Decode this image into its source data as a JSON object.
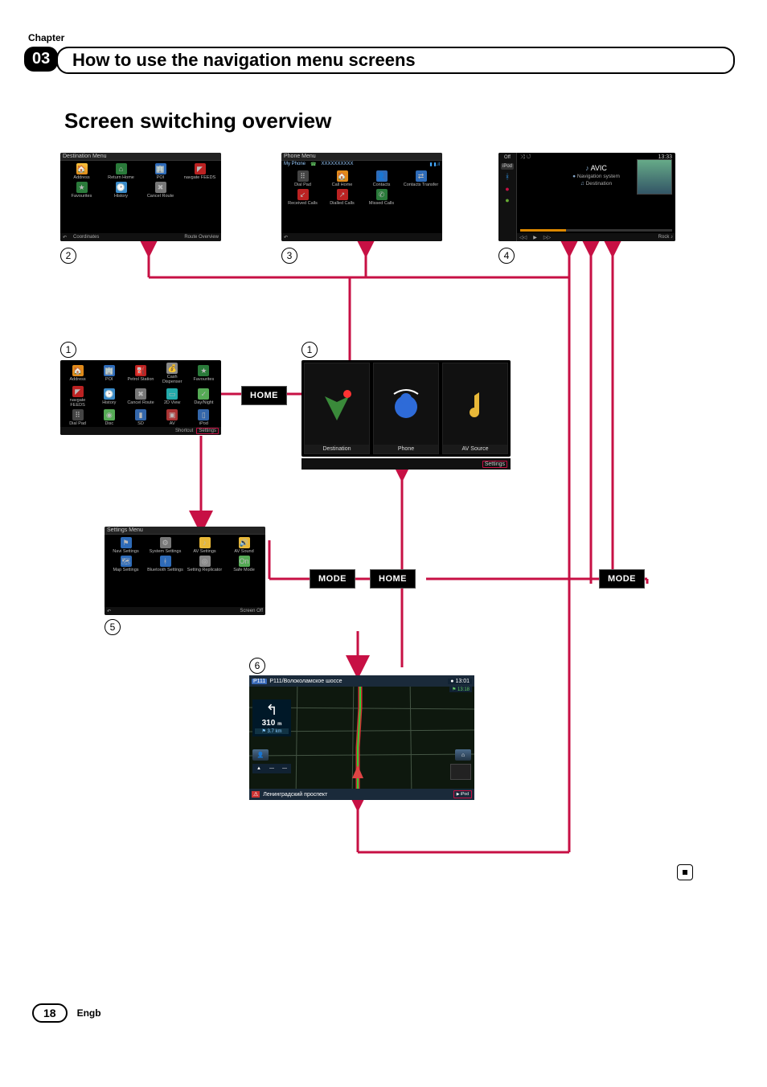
{
  "chapter": {
    "label": "Chapter",
    "number": "03"
  },
  "title": "How to use the navigation menu screens",
  "section": "Screen switching overview",
  "buttons": {
    "home": "HOME",
    "mode": "MODE"
  },
  "callouts": {
    "c1": "1",
    "c2": "2",
    "c3": "3",
    "c4": "4",
    "c5": "5",
    "c6": "6"
  },
  "screens": {
    "destination": {
      "title": "Destination Menu",
      "items": [
        "Address",
        "Return Home",
        "POI",
        "navgate FEEDS",
        "Favourites",
        "History",
        "Cancel Route"
      ],
      "footer": [
        "↶",
        "Coordinates",
        "Route Overview"
      ]
    },
    "phone": {
      "title": "Phone Menu",
      "subtitle": "My Phone",
      "number": "XXXXXXXXXX",
      "signal": "▮ ▮.il",
      "items": [
        "Dial Pad",
        "Call Home",
        "Contacts",
        "Contacts Transfer",
        "Received Calls",
        "Dialled Calls",
        "Missed Calls"
      ],
      "footer": [
        "↶"
      ]
    },
    "av": {
      "off": "Off",
      "clock": "13:33",
      "source": "iPod",
      "title": "AVIC",
      "subtitle": "Navigation system",
      "album": "Destination",
      "footer": [
        "◁◁",
        "▶",
        "▷▷",
        "Rock ♪"
      ]
    },
    "shortcut": {
      "row1": [
        "Address",
        "POI",
        "Petrol Station",
        "Cash Dispenser",
        "Favourites"
      ],
      "row2": [
        "navgate FEEDS",
        "History",
        "Cancel Route",
        "2D View",
        "Day/Night"
      ],
      "row3": [
        "Dial Pad",
        "Disc",
        "SD",
        "AV",
        "iPod"
      ],
      "footer": [
        "Shortcut",
        "Settings"
      ]
    },
    "topmenu": {
      "panes": [
        "Destination",
        "Phone",
        "AV Source"
      ],
      "footer_button": "Settings"
    },
    "settings": {
      "title": "Settings Menu",
      "items": [
        "Navi Settings",
        "System Settings",
        "AV Settings",
        "AV Sound",
        "Map Settings",
        "Bluetooth Settings",
        "Setting Replicator",
        "Safe Mode"
      ],
      "footer": [
        "↶",
        "Screen Off"
      ]
    },
    "map": {
      "road_top": "P111/Волоколамское шоссе",
      "badge_top": "P111",
      "time1": "13:01",
      "time2": "13:18",
      "dist": "310",
      "dist_unit": "m",
      "dist2": "3.7",
      "dist2_unit": "km",
      "road_bottom": "Ленинградский проспект",
      "src": "iPod"
    }
  },
  "footer": {
    "page": "18",
    "lang": "Engb"
  }
}
